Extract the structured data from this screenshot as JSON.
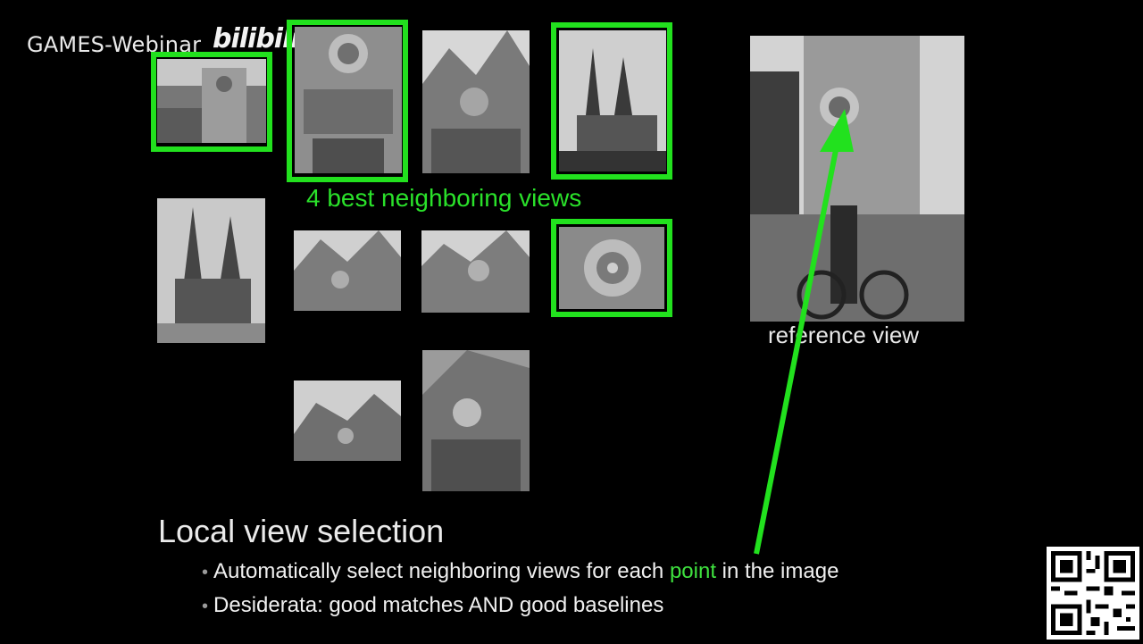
{
  "watermark": {
    "text": "GAMES-Webinar",
    "logo": "bilibili"
  },
  "labels": {
    "best_views": "4 best neighboring views",
    "reference": "reference view"
  },
  "slide": {
    "title": "Local view selection",
    "bullets": [
      {
        "pre": "Automatically select neighboring views for each ",
        "accent": "point",
        "post": " in the image"
      },
      {
        "pre": "Desiderata:  good matches AND good baselines",
        "accent": "",
        "post": ""
      }
    ]
  },
  "colors": {
    "highlight": "#22e11e",
    "background": "#000000"
  },
  "icons": {
    "qr": "qr-code-icon"
  }
}
